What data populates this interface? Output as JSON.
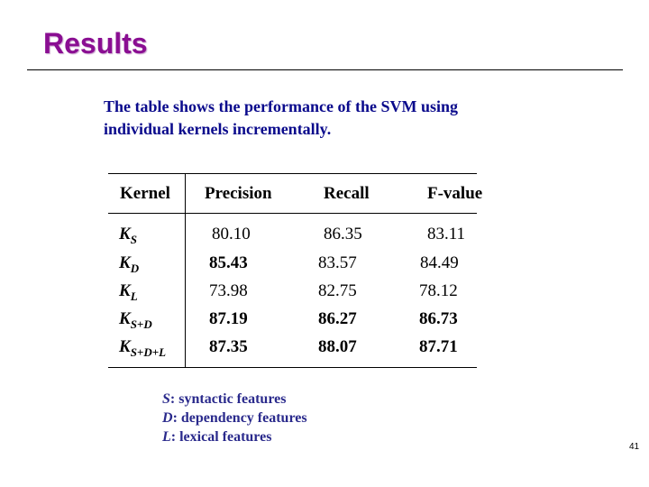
{
  "slide": {
    "title": "Results",
    "intro_lines": [
      "The table shows the performance of the SVM using",
      "individual kernels incrementally."
    ],
    "page_number": "41"
  },
  "table": {
    "headers": [
      "Kernel",
      "Precision",
      "Recall",
      "F-value"
    ],
    "rows": [
      {
        "kernel_base": "K",
        "kernel_sub": "S",
        "precision": "80.10",
        "recall": "86.35",
        "fvalue": "83.11"
      },
      {
        "kernel_base": "K",
        "kernel_sub": "D",
        "precision": "85.43",
        "recall": "83.57",
        "fvalue": "84.49"
      },
      {
        "kernel_base": "K",
        "kernel_sub": "L",
        "precision": "73.98",
        "recall": "82.75",
        "fvalue": "78.12"
      },
      {
        "kernel_base": "K",
        "kernel_sub": "S+D",
        "precision": "87.19",
        "recall": "86.27",
        "fvalue": "86.73"
      },
      {
        "kernel_base": "K",
        "kernel_sub": "S+D+L",
        "precision": "87.35",
        "recall": "88.07",
        "fvalue": "87.71"
      }
    ]
  },
  "legend": [
    {
      "key": "S",
      "text": ": syntactic features"
    },
    {
      "key": "D",
      "text": ": dependency features"
    },
    {
      "key": "L",
      "text": ": lexical features"
    }
  ],
  "colors": {
    "title": "#8a0e92",
    "body_text": "#0a0a8c",
    "legend_text": "#2a2a8c"
  }
}
